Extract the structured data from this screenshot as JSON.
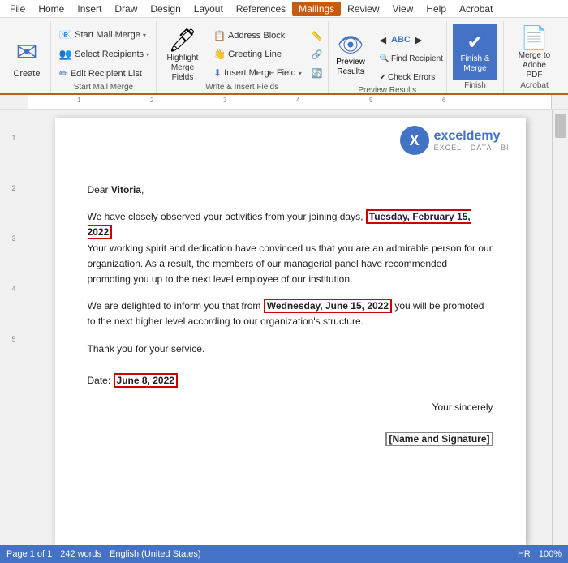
{
  "menubar": {
    "items": [
      "File",
      "Home",
      "Insert",
      "Draw",
      "Design",
      "Layout",
      "References",
      "Mailings",
      "Review",
      "View",
      "Help",
      "Acrobat"
    ],
    "active": "Mailings"
  },
  "ribbon": {
    "groups": [
      {
        "id": "create",
        "label": "",
        "buttons": [
          {
            "id": "create",
            "label": "Create",
            "icon": "✉"
          }
        ]
      },
      {
        "id": "start-mail-merge",
        "label": "Start Mail Merge",
        "buttons": [
          {
            "id": "start-mail-merge",
            "label": "Start Mail Merge",
            "icon": "📧"
          },
          {
            "id": "select-recipients",
            "label": "Select Recipients",
            "icon": "👥"
          },
          {
            "id": "edit-recipient-list",
            "label": "Edit Recipient List",
            "icon": "✏"
          }
        ]
      },
      {
        "id": "write-insert",
        "label": "Write & Insert Fields",
        "buttons": [
          {
            "id": "highlight",
            "label": "Highlight\nMerge Fields",
            "icon": "🖊"
          },
          {
            "id": "address-block",
            "label": "Address Block",
            "icon": "📋"
          },
          {
            "id": "greeting-line",
            "label": "Greeting Line",
            "icon": "👋"
          },
          {
            "id": "insert-merge-field",
            "label": "Insert Merge Field",
            "icon": "⬇"
          },
          {
            "id": "rules",
            "label": "Rules",
            "icon": "📏"
          },
          {
            "id": "match-fields",
            "label": "Match Fields",
            "icon": "🔗"
          },
          {
            "id": "update-labels",
            "label": "Update Labels",
            "icon": "🔄"
          }
        ]
      },
      {
        "id": "preview",
        "label": "Preview Results",
        "buttons": [
          {
            "id": "preview-results",
            "label": "Preview\nResults",
            "icon": "👁"
          },
          {
            "id": "nav-prev",
            "label": "",
            "icon": "◀"
          },
          {
            "id": "nav-num",
            "label": "ABC",
            "icon": ""
          },
          {
            "id": "nav-next",
            "label": "",
            "icon": "▶"
          },
          {
            "id": "find-recipient",
            "label": "Find Recipient",
            "icon": "🔍"
          },
          {
            "id": "check-errors",
            "label": "Check Errors",
            "icon": "✔"
          }
        ]
      },
      {
        "id": "finish",
        "label": "Finish",
        "buttons": [
          {
            "id": "finish-merge",
            "label": "Finish &\nMerge",
            "icon": "✔"
          }
        ]
      },
      {
        "id": "acrobat",
        "label": "Acrobat",
        "buttons": [
          {
            "id": "merge-to-pdf",
            "label": "Merge to\nAdobe PDF",
            "icon": "📄"
          }
        ]
      }
    ]
  },
  "document": {
    "greeting": "Dear ",
    "name": "Vitoria",
    "comma": ",",
    "paragraph1_pre": "We have closely observed your activities from your joining days, ",
    "date1": "Tuesday, February 15, 2022",
    "paragraph1_post": "Your working spirit and dedication have convinced us that you are an admirable person for our organization. As a result, the members of our managerial panel have recommended promoting you up to the next level employee of our institution.",
    "paragraph2_pre": "We are delighted to inform you that from ",
    "date2": "Wednesday, June 15, 2022",
    "paragraph2_post": " you will be promoted to the next higher level according to our organization's structure.",
    "paragraph3": "Thank you for your service.",
    "date_label": "Date:",
    "date3": "June 8, 2022",
    "closing1": "Your sincerely",
    "closing2": "[Name and Signature]"
  },
  "logo": {
    "icon": "X",
    "name": "exceldemy",
    "tagline": "EXCEL · DATA · BI"
  },
  "statusbar": {
    "left": [
      "Page 1 of 1",
      "242 words",
      "English (United States)"
    ],
    "right": [
      "HR",
      "100%"
    ]
  },
  "ruler": {
    "marks": [
      "1",
      "2",
      "3",
      "4",
      "5",
      "6"
    ],
    "side_marks": [
      "1",
      "2",
      "3",
      "4",
      "5"
    ]
  }
}
